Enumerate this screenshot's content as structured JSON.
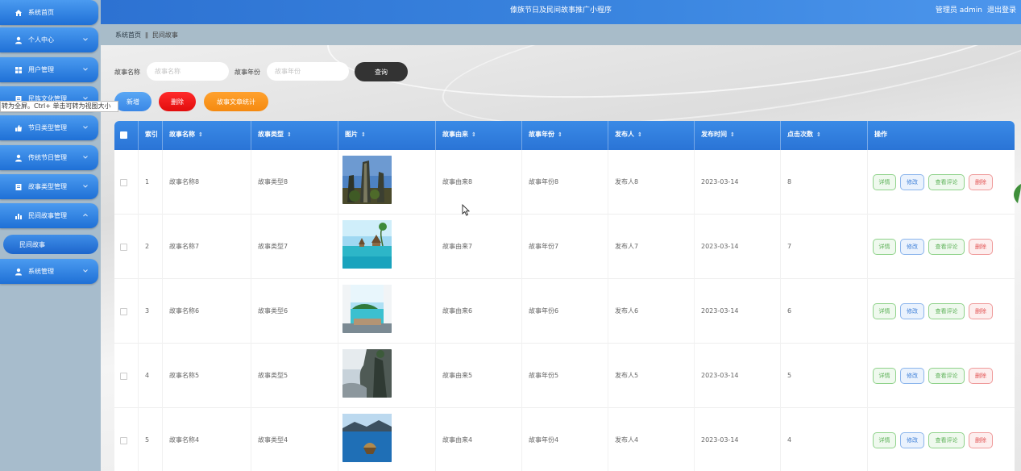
{
  "header": {
    "title": "傣族节日及民间故事推广小程序",
    "user": "管理员 admin",
    "logout": "退出登录",
    "accent_color": "#3078d8"
  },
  "tooltip": "转为全屏。Ctrl+ 单击可转为视图大小",
  "sidebar": {
    "items": [
      {
        "label": "系统首页",
        "icon": "home-icon",
        "expandable": false
      },
      {
        "label": "个人中心",
        "icon": "person-icon",
        "expandable": true
      },
      {
        "label": "用户管理",
        "icon": "grid-icon",
        "expandable": true
      },
      {
        "label": "民族文化管理",
        "icon": "document-icon",
        "expandable": true
      },
      {
        "label": "节日类型管理",
        "icon": "thumbs-up-icon",
        "expandable": true
      },
      {
        "label": "传统节日管理",
        "icon": "person-icon",
        "expandable": true
      },
      {
        "label": "故事类型管理",
        "icon": "document-icon",
        "expandable": true
      },
      {
        "label": "民间故事管理",
        "icon": "bar-chart-icon",
        "expandable": true,
        "expanded": true
      },
      {
        "label": "系统管理",
        "icon": "person-icon",
        "expandable": true
      }
    ],
    "submenu": {
      "label": "民间故事"
    }
  },
  "breadcrumb": {
    "home": "系统首页",
    "separator": "ǁ",
    "current": "民间故事"
  },
  "search": {
    "name_label": "故事名称",
    "name_placeholder": "故事名称",
    "year_label": "故事年份",
    "year_placeholder": "故事年份",
    "query_label": "查询"
  },
  "actions": {
    "add": "新增",
    "delete": "删除",
    "stats": "故事文章统计"
  },
  "table": {
    "columns": [
      "索引",
      "故事名称",
      "故事类型",
      "图片",
      "故事由来",
      "故事年份",
      "发布人",
      "发布时间",
      "点击次数",
      "操作"
    ],
    "ops": {
      "detail": "详情",
      "edit": "修改",
      "comments": "查看评论",
      "delete": "删除"
    },
    "rows": [
      {
        "index": "1",
        "name": "故事名称8",
        "type": "故事类型8",
        "image": "stone-pillars-photo",
        "origin": "故事由来8",
        "year": "故事年份8",
        "publisher": "发布人8",
        "time": "2023-03-14",
        "clicks": "8"
      },
      {
        "index": "2",
        "name": "故事名称7",
        "type": "故事类型7",
        "image": "tropical-bungalows-photo",
        "origin": "故事由来7",
        "year": "故事年份7",
        "publisher": "发布人7",
        "time": "2023-03-14",
        "clicks": "7"
      },
      {
        "index": "3",
        "name": "故事名称6",
        "type": "故事类型6",
        "image": "beach-window-photo",
        "origin": "故事由来6",
        "year": "故事年份6",
        "publisher": "发布人6",
        "time": "2023-03-14",
        "clicks": "6"
      },
      {
        "index": "4",
        "name": "故事名称5",
        "type": "故事类型5",
        "image": "cliff-mountain-photo",
        "origin": "故事由来5",
        "year": "故事年份5",
        "publisher": "发布人5",
        "time": "2023-03-14",
        "clicks": "5"
      },
      {
        "index": "5",
        "name": "故事名称4",
        "type": "故事类型4",
        "image": "lake-island-photo",
        "origin": "故事由来4",
        "year": "故事年份4",
        "publisher": "发布人4",
        "time": "2023-03-14",
        "clicks": "4"
      }
    ]
  }
}
